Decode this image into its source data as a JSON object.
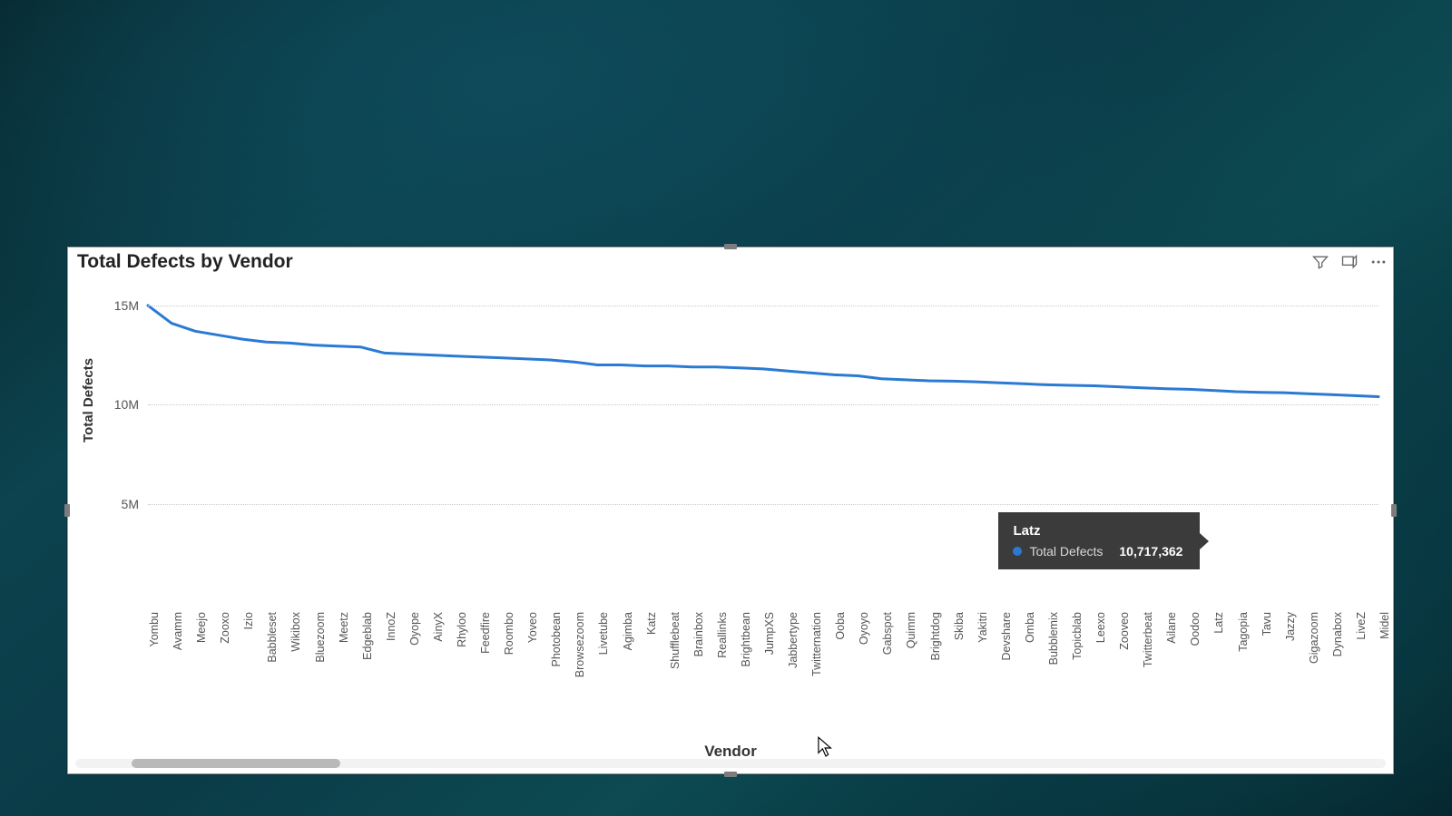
{
  "card": {
    "title": "Total Defects by Vendor",
    "icons": [
      "filter",
      "focus-mode",
      "more-options"
    ]
  },
  "axes": {
    "y_title": "Total Defects",
    "x_title": "Vendor",
    "y_ticks": [
      "5M",
      "10M",
      "15M"
    ]
  },
  "tooltip": {
    "category": "Latz",
    "metric": "Total Defects",
    "value": "10,717,362"
  },
  "line_color": "#2a7ad4",
  "chart_data": {
    "type": "line",
    "title": "Total Defects by Vendor",
    "xlabel": "Vendor",
    "ylabel": "Total Defects",
    "ylim": [
      0,
      16000000
    ],
    "y_tick_values": [
      5000000,
      10000000,
      15000000
    ],
    "categories": [
      "Yombu",
      "Avamm",
      "Meejo",
      "Zooxo",
      "Izio",
      "Babbleset",
      "Wikibox",
      "Bluezoom",
      "Meetz",
      "Edgeblab",
      "InnoZ",
      "Oyope",
      "AinyX",
      "Rhyloo",
      "Feedfire",
      "Roombo",
      "Yoveo",
      "Photobean",
      "Browsezoom",
      "Livetube",
      "Agimba",
      "Katz",
      "Shufflebeat",
      "Brainbox",
      "Reallinks",
      "Brightbean",
      "JumpXS",
      "Jabbertype",
      "Twitternation",
      "Ooba",
      "Oyoyo",
      "Gabspot",
      "Quimm",
      "Brightdog",
      "Skiba",
      "Yakitri",
      "Devshare",
      "Omba",
      "Bubblemix",
      "Topicblab",
      "Leexo",
      "Zooveo",
      "Twitterbeat",
      "Ailane",
      "Oodoo",
      "Latz",
      "Tagopia",
      "Tavu",
      "Jazzy",
      "Gigazoom",
      "Dynabox",
      "LiveZ",
      "Midel"
    ],
    "series": [
      {
        "name": "Total Defects",
        "values": [
          15000000,
          14100000,
          13700000,
          13500000,
          13300000,
          13150000,
          13100000,
          13000000,
          12950000,
          12900000,
          12600000,
          12550000,
          12500000,
          12450000,
          12400000,
          12350000,
          12300000,
          12250000,
          12150000,
          12000000,
          12000000,
          11950000,
          11950000,
          11900000,
          11900000,
          11850000,
          11800000,
          11700000,
          11600000,
          11500000,
          11450000,
          11300000,
          11250000,
          11200000,
          11180000,
          11150000,
          11100000,
          11050000,
          11000000,
          10970000,
          10950000,
          10900000,
          10850000,
          10800000,
          10770000,
          10717362,
          10650000,
          10620000,
          10600000,
          10550000,
          10500000,
          10450000,
          10400000
        ]
      }
    ],
    "highlight": {
      "category": "Latz",
      "value": 10717362
    }
  }
}
